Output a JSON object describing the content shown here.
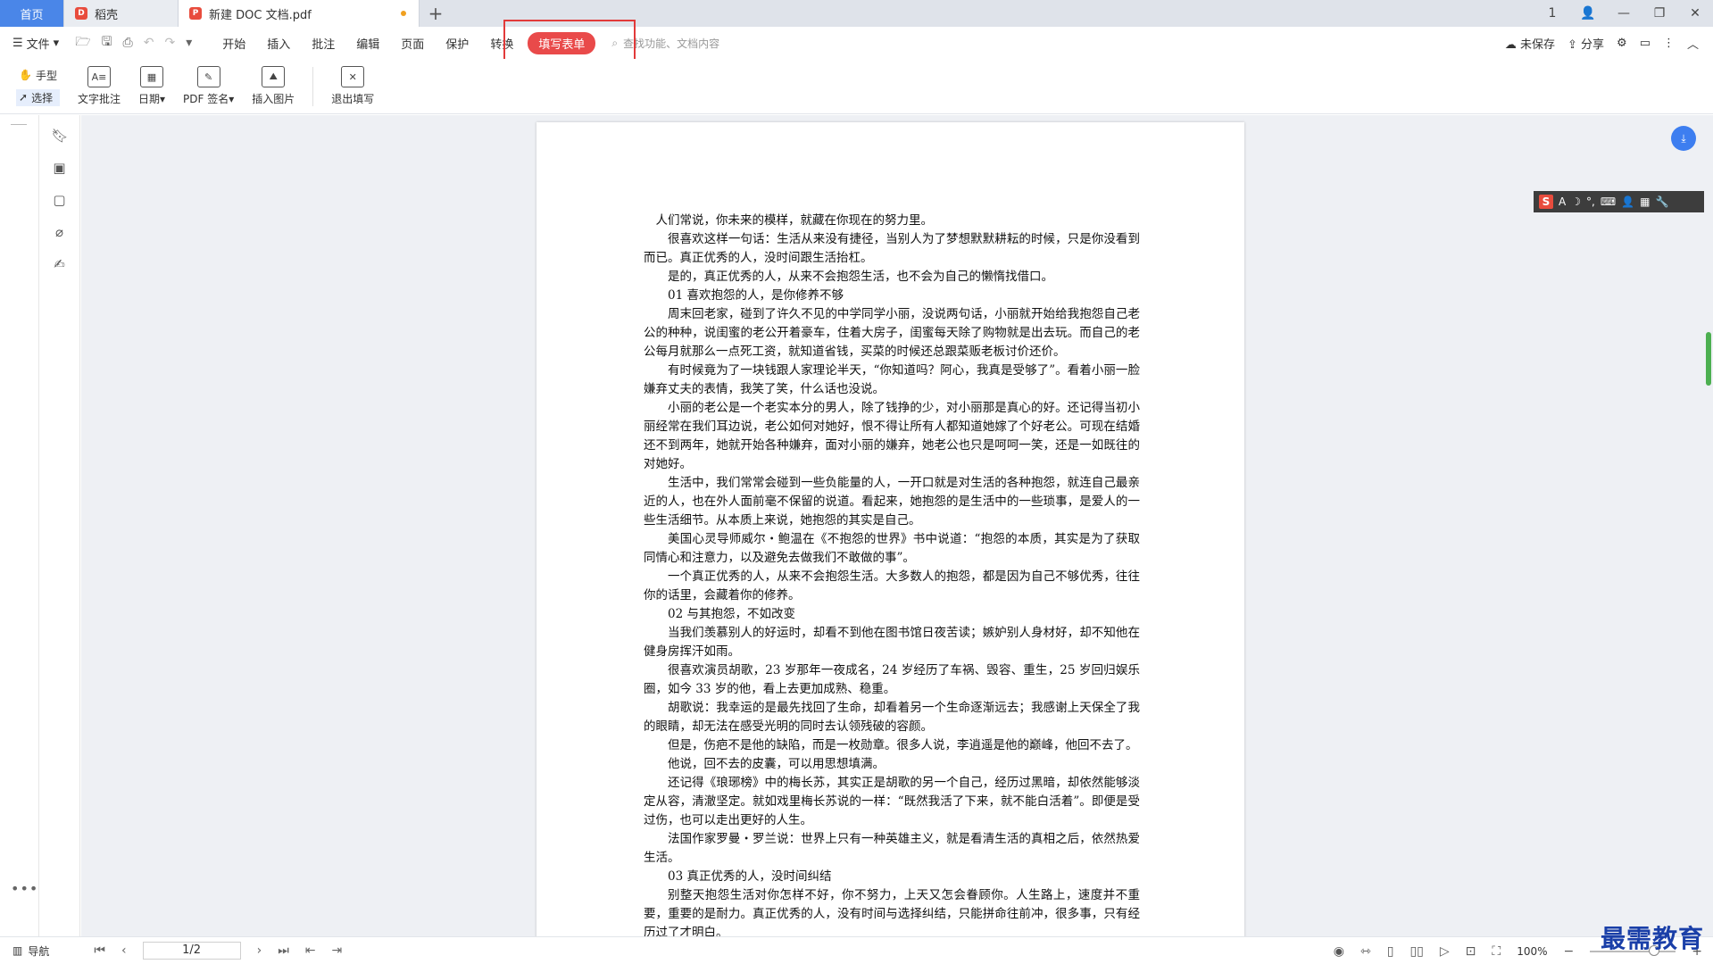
{
  "tabs": {
    "home": "首页",
    "daoke": "稻壳",
    "doc": "新建 DOC 文档.pdf",
    "add": "+"
  },
  "window_controls": [
    "1",
    "👤",
    "—",
    "❐",
    "✕"
  ],
  "menu": {
    "file": "文件",
    "items": [
      "开始",
      "插入",
      "批注",
      "编辑",
      "页面",
      "保护",
      "转换"
    ],
    "active": "填写表单",
    "search_placeholder": "查找功能、文档内容",
    "unsaved": "未保存",
    "share": "分享"
  },
  "toolbar": {
    "hand": "手型",
    "select": "选择",
    "text_annot": "文字批注",
    "date": "日期",
    "pdf_sign": "PDF 签名",
    "insert_image": "插入图片",
    "exit_fill": "退出填写"
  },
  "document": {
    "paragraphs": [
      {
        "type": "plain",
        "text": "人们常说，你未来的模样，就藏在你现在的努力里。"
      },
      {
        "type": "p",
        "text": "很喜欢这样一句话：生活从来没有捷径，当别人为了梦想默默耕耘的时候，只是你没看到而已。真正优秀的人，没时间跟生活抬杠。"
      },
      {
        "type": "p",
        "text": "是的，真正优秀的人，从来不会抱怨生活，也不会为自己的懒惰找借口。"
      },
      {
        "type": "head",
        "text": "01  喜欢抱怨的人，是你修养不够"
      },
      {
        "type": "p",
        "text": "周末回老家，碰到了许久不见的中学同学小丽，没说两句话，小丽就开始给我抱怨自己老公的种种，说闺蜜的老公开着豪车，住着大房子，闺蜜每天除了购物就是出去玩。而自己的老公每月就那么一点死工资，就知道省钱，买菜的时候还总跟菜贩老板讨价还价。"
      },
      {
        "type": "p",
        "text": "有时候竟为了一块钱跟人家理论半天，“你知道吗？阿心，我真是受够了”。看着小丽一脸嫌弃丈夫的表情，我笑了笑，什么话也没说。"
      },
      {
        "type": "p",
        "text": "小丽的老公是一个老实本分的男人，除了钱挣的少，对小丽那是真心的好。还记得当初小丽经常在我们耳边说，老公如何对她好，恨不得让所有人都知道她嫁了个好老公。可现在结婚还不到两年，她就开始各种嫌弃，面对小丽的嫌弃，她老公也只是呵呵一笑，还是一如既往的对她好。"
      },
      {
        "type": "p",
        "text": "生活中，我们常常会碰到一些负能量的人，一开口就是对生活的各种抱怨，就连自己最亲近的人，也在外人面前毫不保留的说道。看起来，她抱怨的是生活中的一些琐事，是爱人的一些生活细节。从本质上来说，她抱怨的其实是自己。"
      },
      {
        "type": "p",
        "text": "美国心灵导师威尔・鲍温在《不抱怨的世界》书中说道：“抱怨的本质，其实是为了获取同情心和注意力，以及避免去做我们不敢做的事”。"
      },
      {
        "type": "p",
        "text": "一个真正优秀的人，从来不会抱怨生活。大多数人的抱怨，都是因为自己不够优秀，往往你的话里，会藏着你的修养。"
      },
      {
        "type": "head",
        "text": "02  与其抱怨，不如改变"
      },
      {
        "type": "p",
        "text": "当我们羡慕别人的好运时，却看不到他在图书馆日夜苦读；嫉妒别人身材好，却不知他在健身房挥汗如雨。"
      },
      {
        "type": "p",
        "text": "很喜欢演员胡歌，23 岁那年一夜成名，24 岁经历了车祸、毁容、重生，25 岁回归娱乐圈，如今 33 岁的他，看上去更加成熟、稳重。"
      },
      {
        "type": "p",
        "text": "胡歌说：我幸运的是最先找回了生命，却看着另一个生命逐渐远去；我感谢上天保全了我的眼睛，却无法在感受光明的同时去认领残破的容颜。"
      },
      {
        "type": "p",
        "text": "但是，伤疤不是他的缺陷，而是一枚勋章。很多人说，李逍遥是他的巅峰，他回不去了。"
      },
      {
        "type": "p",
        "text": "他说，回不去的皮囊，可以用思想填满。"
      },
      {
        "type": "p",
        "text": "还记得《琅琊榜》中的梅长苏，其实正是胡歌的另一个自己，经历过黑暗，却依然能够淡定从容，清澈坚定。就如戏里梅长苏说的一样：“既然我活了下来，就不能白活着”。即便是受过伤，也可以走出更好的人生。"
      },
      {
        "type": "p",
        "text": "法国作家罗曼・罗兰说：世界上只有一种英雄主义，就是看清生活的真相之后，依然热爱生活。"
      },
      {
        "type": "head",
        "text": "03  真正优秀的人，没时间纠结"
      },
      {
        "type": "p",
        "text": "别整天抱怨生活对你怎样不好，你不努力，上天又怎会眷顾你。人生路上，速度并不重要，重要的是耐力。真正优秀的人，没有时间与选择纠结，只能拼命往前冲，很多事，只有经历过了才明白。"
      }
    ]
  },
  "statusbar": {
    "nav": "导航",
    "page": "1/2",
    "zoom": "100%"
  },
  "watermark": "最需教育",
  "colors": {
    "accent": "#4a86e8",
    "active_tab": "#e94a4a",
    "highlight": "#e23a3a"
  }
}
